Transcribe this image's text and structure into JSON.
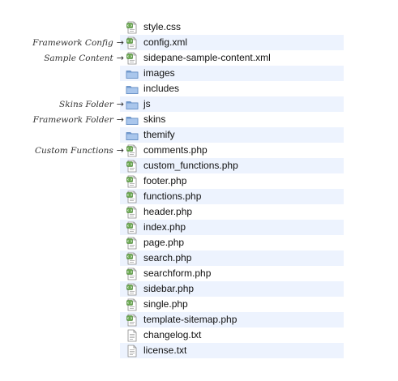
{
  "annotations": [
    {
      "label": "Framework Config",
      "row": 1
    },
    {
      "label": "Sample Content",
      "row": 2
    },
    {
      "label": "Skins Folder",
      "row": 5
    },
    {
      "label": "Framework Folder",
      "row": 6
    },
    {
      "label": "Custom Functions",
      "row": 8
    }
  ],
  "arrow_glyph": "→",
  "files": [
    {
      "name": "style.css",
      "icon": "code-file-icon"
    },
    {
      "name": "config.xml",
      "icon": "code-file-icon"
    },
    {
      "name": "sidepane-sample-content.xml",
      "icon": "code-file-icon"
    },
    {
      "name": "images",
      "icon": "folder-icon"
    },
    {
      "name": "includes",
      "icon": "folder-icon"
    },
    {
      "name": "js",
      "icon": "folder-icon"
    },
    {
      "name": "skins",
      "icon": "folder-icon"
    },
    {
      "name": "themify",
      "icon": "folder-icon"
    },
    {
      "name": "comments.php",
      "icon": "code-file-icon"
    },
    {
      "name": "custom_functions.php",
      "icon": "code-file-icon"
    },
    {
      "name": "footer.php",
      "icon": "code-file-icon"
    },
    {
      "name": "functions.php",
      "icon": "code-file-icon"
    },
    {
      "name": "header.php",
      "icon": "code-file-icon"
    },
    {
      "name": "index.php",
      "icon": "code-file-icon"
    },
    {
      "name": "page.php",
      "icon": "code-file-icon"
    },
    {
      "name": "search.php",
      "icon": "code-file-icon"
    },
    {
      "name": "searchform.php",
      "icon": "code-file-icon"
    },
    {
      "name": "sidebar.php",
      "icon": "code-file-icon"
    },
    {
      "name": "single.php",
      "icon": "code-file-icon"
    },
    {
      "name": "template-sitemap.php",
      "icon": "code-file-icon"
    },
    {
      "name": "changelog.txt",
      "icon": "text-file-icon"
    },
    {
      "name": "license.txt",
      "icon": "text-file-icon"
    }
  ],
  "colors": {
    "row_alt": "#edf3fe",
    "folder": "#8fb2e0",
    "code_badge": "#6aa84f"
  }
}
